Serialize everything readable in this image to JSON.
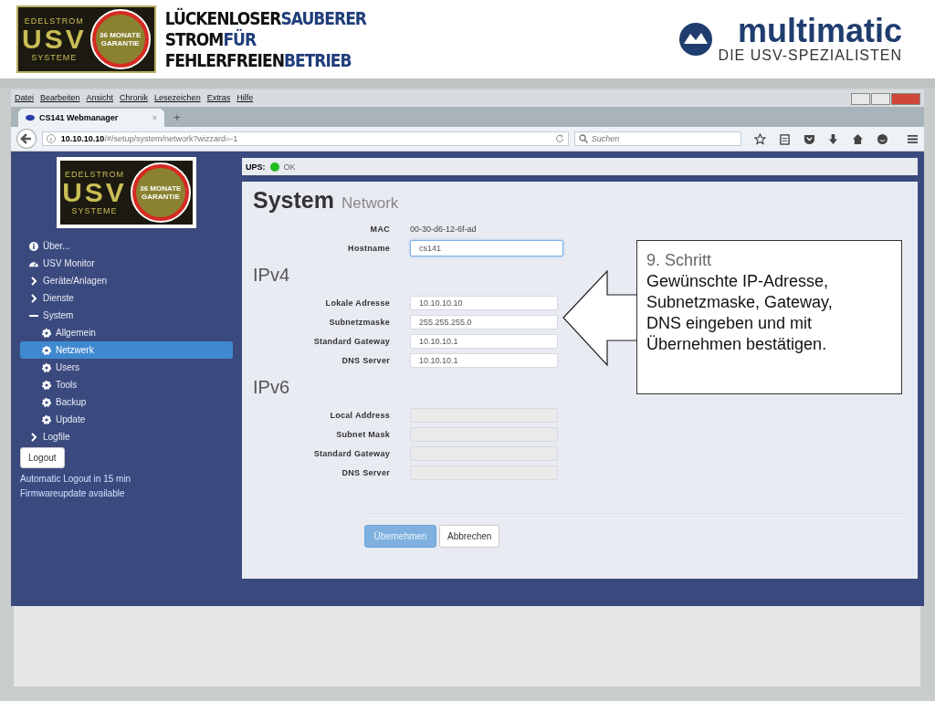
{
  "slide_header": {
    "brand_logo": {
      "top": "EDELSTROM",
      "main": "USV",
      "bottom": "SYSTEME",
      "seal": "36 MONATE GARANTIE"
    },
    "slogan": [
      {
        "dark": "LÜCKENLOSER",
        "accent": "SAUBERER"
      },
      {
        "dark": "STROM",
        "accent": "FÜR"
      },
      {
        "dark": "FEHLERFREIEN",
        "accent": "BETRIEB"
      }
    ],
    "company_logo": {
      "name": "multimatic",
      "tagline": "DIE USV-SPEZIALISTEN"
    }
  },
  "browser": {
    "menu": [
      "Datei",
      "Bearbeiten",
      "Ansicht",
      "Chronik",
      "Lesezeichen",
      "Extras",
      "Hilfe"
    ],
    "tab": {
      "title": "CS141 Webmanager",
      "close": "×",
      "new": "+"
    },
    "url": {
      "host": "10.10.10.10",
      "path": "/#/setup/system/network?wizzard=-1"
    },
    "search": {
      "placeholder": "Suchen"
    }
  },
  "sidebar": {
    "logo": {
      "top": "EDELSTROM",
      "main": "USV",
      "bottom": "SYSTEME",
      "seal": "36 MONATE GARANTIE"
    },
    "items": [
      {
        "label": "Über...",
        "kind": "info",
        "selected": false
      },
      {
        "label": "USV Monitor",
        "kind": "gauge",
        "selected": false
      },
      {
        "label": "Geräte/Anlagen",
        "kind": "group",
        "expanded": false,
        "selected": false
      },
      {
        "label": "Dienste",
        "kind": "group",
        "expanded": false,
        "selected": false
      },
      {
        "label": "System",
        "kind": "group",
        "expanded": true,
        "selected": false,
        "children": [
          {
            "label": "Allgemein",
            "kind": "gear",
            "selected": false
          },
          {
            "label": "Netzwerk",
            "kind": "gear",
            "selected": true
          },
          {
            "label": "Users",
            "kind": "gear",
            "selected": false
          },
          {
            "label": "Tools",
            "kind": "gear",
            "selected": false
          },
          {
            "label": "Backup",
            "kind": "gear",
            "selected": false
          },
          {
            "label": "Update",
            "kind": "gear",
            "selected": false
          }
        ]
      },
      {
        "label": "Logfile",
        "kind": "group",
        "expanded": false,
        "selected": false
      }
    ],
    "logout": "Logout",
    "notes": [
      "Automatic Logout in 15 min",
      "Firmwareupdate available"
    ]
  },
  "status": {
    "label": "UPS:",
    "value": "OK",
    "color": "#22bb22"
  },
  "page": {
    "title": "System",
    "subtitle": "Network",
    "fields": [
      {
        "label": "MAC",
        "kind": "text",
        "value": "00-30-d6-12-6f-ad"
      },
      {
        "label": "Hostname",
        "kind": "input",
        "value": "cs141",
        "focused": true,
        "disabled": false
      }
    ],
    "sections": [
      {
        "title": "IPv4",
        "fields": [
          {
            "label": "Lokale Adresse",
            "value": "10.10.10.10",
            "focused": false,
            "disabled": false
          },
          {
            "label": "Subnetzmaske",
            "value": "255.255.255.0",
            "focused": false,
            "disabled": false
          },
          {
            "label": "Standard Gateway",
            "value": "10.10.10.1",
            "focused": false,
            "disabled": false
          },
          {
            "label": "DNS Server",
            "value": "10.10.10.1",
            "focused": false,
            "disabled": false
          }
        ]
      },
      {
        "title": "IPv6",
        "fields": [
          {
            "label": "Local Address",
            "focused": false,
            "disabled": true
          },
          {
            "label": "Subnet Mask",
            "focused": false,
            "disabled": true
          },
          {
            "label": "Standard Gateway",
            "focused": false,
            "disabled": true
          },
          {
            "label": "DNS Server",
            "focused": false,
            "disabled": true
          }
        ]
      }
    ],
    "buttons": [
      {
        "label": "Übernehmen",
        "kind": "primary"
      },
      {
        "label": "Abbrechen",
        "kind": "default"
      }
    ]
  },
  "callout": {
    "title": "9. Schritt",
    "text": "Gewünschte IP-Adresse, Subnetzmaske, Gateway, DNS eingeben und mit Übernehmen bestätigen."
  }
}
